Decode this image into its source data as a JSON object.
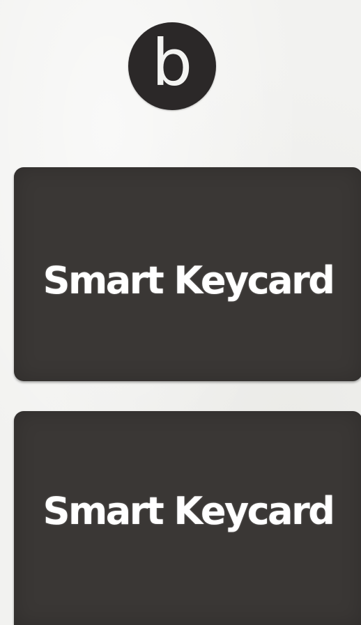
{
  "badge": {
    "letter": "b"
  },
  "cards": [
    {
      "label": "Smart Keycard"
    },
    {
      "label": "Smart Keycard"
    }
  ],
  "colors": {
    "background": "#f2f2f0",
    "card": "#3a3735",
    "badge": "#2b2828",
    "text": "#ffffff"
  }
}
